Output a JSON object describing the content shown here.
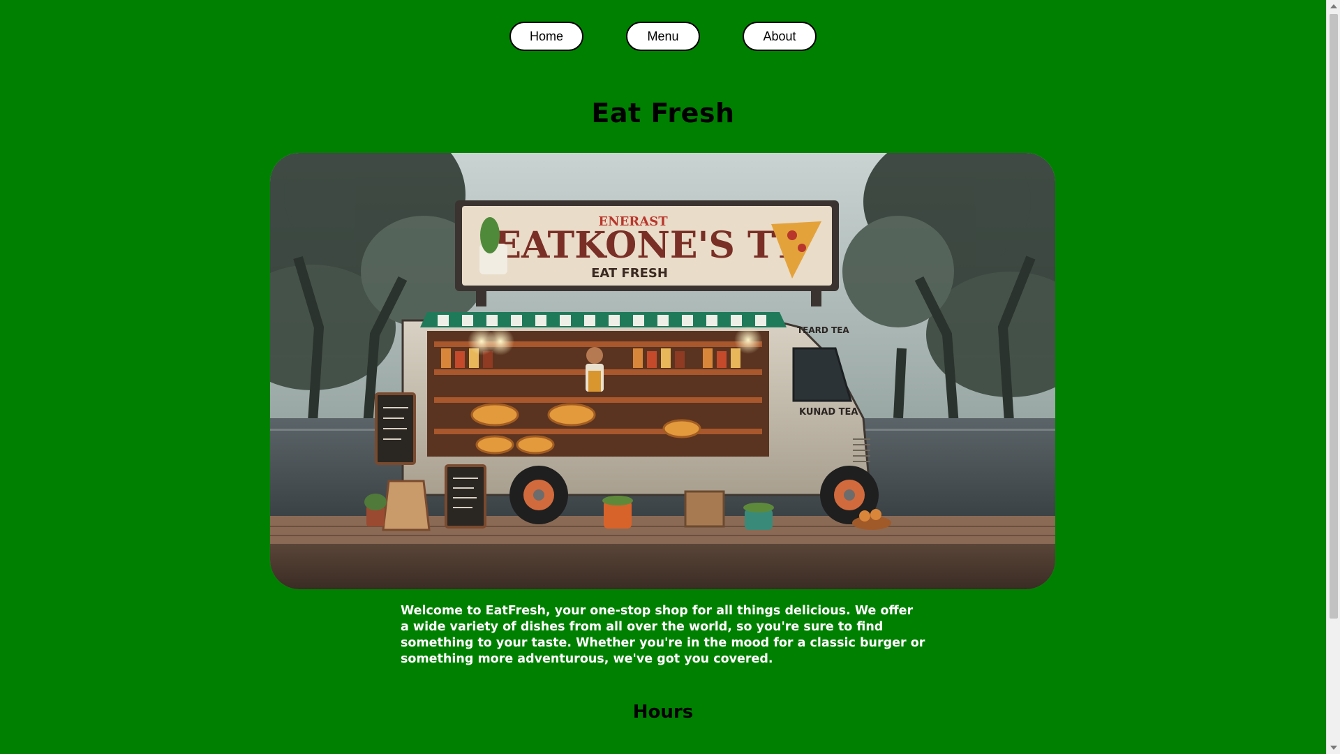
{
  "nav": {
    "home_label": "Home",
    "menu_label": "Menu",
    "about_label": "About"
  },
  "page": {
    "title": "Eat Fresh",
    "intro": "Welcome to EatFresh, your one-stop shop for all things delicious. We offer a wide variety of dishes from all over the world, so you're sure to find something to your taste. Whether you're in the mood for a classic burger or something more adventurous, we've got you covered.",
    "hours_heading": "Hours"
  },
  "hero": {
    "description": "food truck illustration",
    "sign_top": "ENERAST",
    "sign_main": "EATKONE'S TT",
    "sign_sub": "EAT FRESH",
    "side_label": "TEARD TEA",
    "door_label": "KUNAD TEA"
  },
  "colors": {
    "page_background": "#008000",
    "button_background": "#ffffff",
    "intro_text": "#ffffff"
  }
}
